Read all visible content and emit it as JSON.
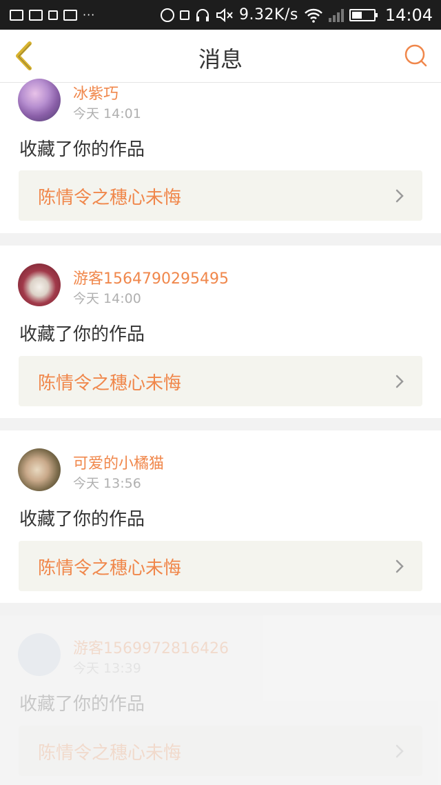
{
  "status_bar": {
    "net_speed": "9.32K/s",
    "time": "14:04",
    "overflow": "···"
  },
  "header": {
    "title": "消息",
    "back_icon": "chevron-left-icon",
    "search_icon": "search-icon"
  },
  "colors": {
    "accent": "#f0874b",
    "back_arrow": "#d8b32f",
    "link_bg": "#f4f4ee"
  },
  "messages": [
    {
      "username": "冰紫巧",
      "time": "今天 14:01",
      "action": "收藏了你的作品",
      "work_title": "陈情令之穗心未悔"
    },
    {
      "username": "游客1564790295495",
      "time": "今天 14:00",
      "action": "收藏了你的作品",
      "work_title": "陈情令之穗心未悔"
    },
    {
      "username": "可爱的小橘猫",
      "time": "今天 13:56",
      "action": "收藏了你的作品",
      "work_title": "陈情令之穗心未悔"
    },
    {
      "username": "游客1569972816426",
      "time": "今天 13:39",
      "action": "收藏了你的作品",
      "work_title": "陈情令之穗心未悔"
    }
  ]
}
